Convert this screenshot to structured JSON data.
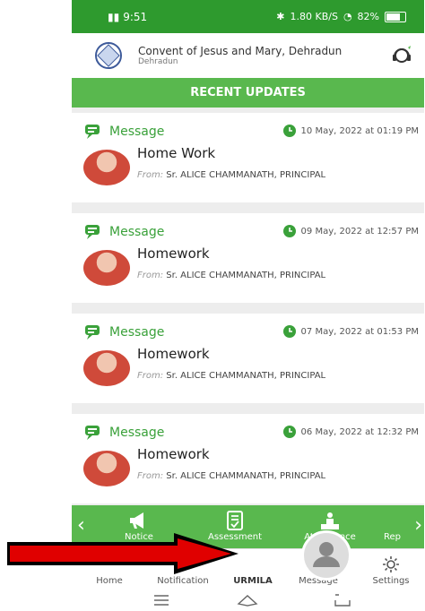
{
  "status": {
    "left": "9:51",
    "battery": "82%",
    "net": "1.80 KB/S"
  },
  "header": {
    "school_name": "Convent of Jesus and Mary, Dehradun",
    "city": "Dehradun"
  },
  "section_title": "RECENT UPDATES",
  "messages": [
    {
      "type": "Message",
      "date": "10 May, 2022 at 01:19 PM",
      "title": "Home Work",
      "from_label": "From:",
      "from": "Sr. ALICE CHAMMANATH, PRINCIPAL"
    },
    {
      "type": "Message",
      "date": "09 May, 2022 at 12:57 PM",
      "title": "Homework",
      "from_label": "From:",
      "from": "Sr. ALICE CHAMMANATH, PRINCIPAL"
    },
    {
      "type": "Message",
      "date": "07 May, 2022 at 01:53 PM",
      "title": "Homework",
      "from_label": "From:",
      "from": "Sr. ALICE CHAMMANATH, PRINCIPAL"
    },
    {
      "type": "Message",
      "date": "06 May, 2022 at 12:32 PM",
      "title": "Homework",
      "from_label": "From:",
      "from": "Sr. ALICE CHAMMANATH, PRINCIPAL"
    }
  ],
  "tabs": [
    {
      "label": "Notice",
      "icon": "megaphone-icon"
    },
    {
      "label": "Assessment",
      "icon": "assessment-icon"
    },
    {
      "label": "Attendance",
      "icon": "attendance-icon"
    },
    {
      "label": "Rep",
      "icon": "report-icon"
    }
  ],
  "nav": [
    {
      "label": "Home",
      "icon": "home-icon"
    },
    {
      "label": "Notification",
      "icon": "bell-icon"
    },
    {
      "label": "URMILA",
      "icon": "profile-icon"
    },
    {
      "label": "Message",
      "icon": "message-icon"
    },
    {
      "label": "Settings",
      "icon": "gear-icon"
    }
  ],
  "colors": {
    "status_green": "#2e9a2e",
    "accent_green": "#59b84e",
    "message_green": "#3aa13a",
    "annotation_red": "#e00000"
  }
}
